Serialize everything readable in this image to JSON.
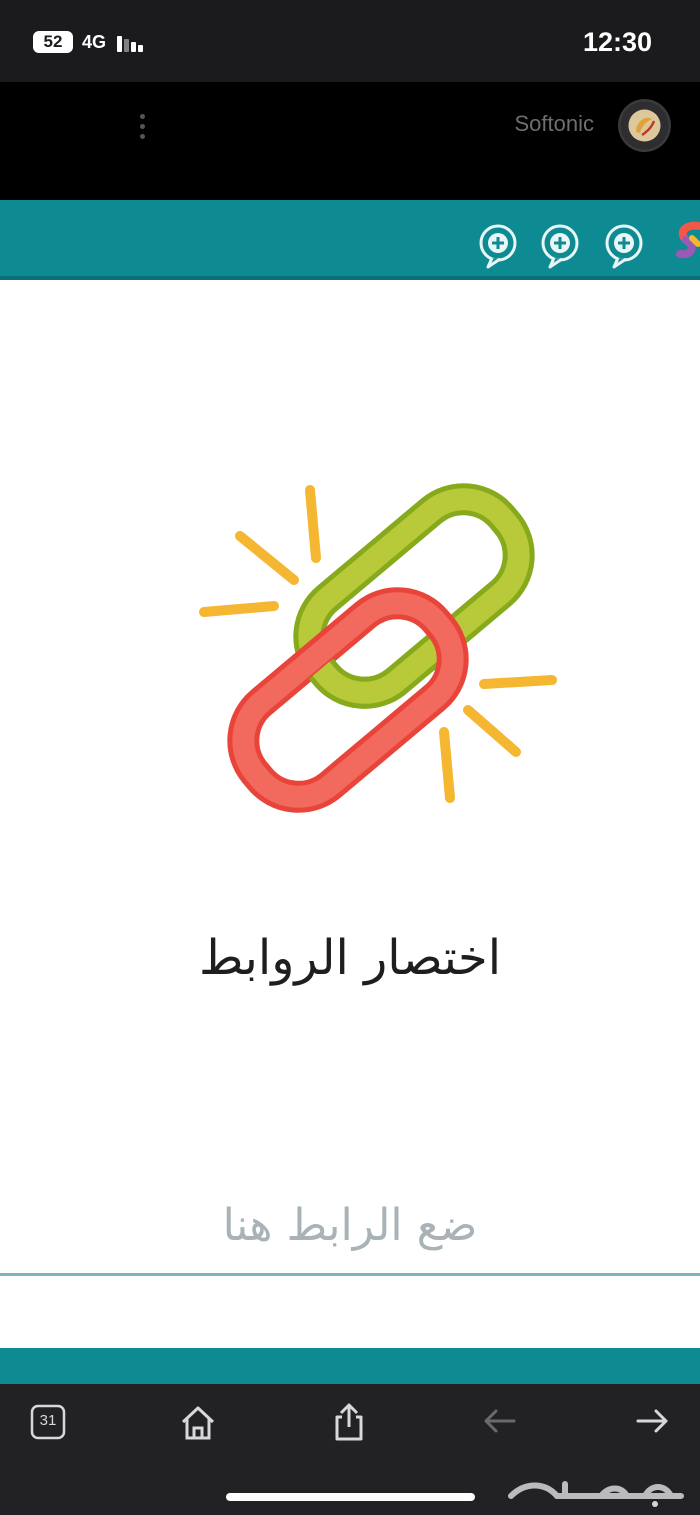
{
  "status_bar": {
    "notification_count": "52",
    "network": "4G",
    "time": "12:30"
  },
  "app_bar": {
    "app_name": "Softonic"
  },
  "toolbar": {
    "icons": [
      "add-bubble-icon",
      "add-bubble-icon",
      "add-bubble-icon",
      "s-logo-icon"
    ]
  },
  "main": {
    "title": "اختصار الروابط",
    "input_placeholder": "ضع الرابط هنا"
  },
  "bottom_nav": {
    "calendar_day": "31",
    "items": [
      "calendar-icon",
      "home-icon",
      "share-icon",
      "back-arrow-icon",
      "forward-arrow-icon"
    ]
  },
  "colors": {
    "teal": "#0e8a93",
    "status_bar": "#1b1b1d",
    "nav_bar": "#222224",
    "chain_green": "#9bbf2b",
    "chain_red": "#f2574a",
    "spark_yellow": "#f5b731"
  }
}
